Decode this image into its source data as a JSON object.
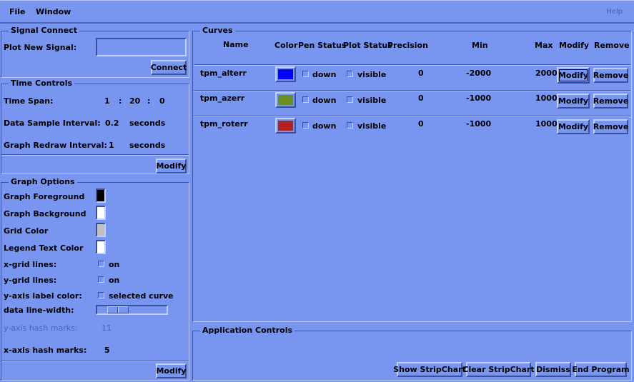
{
  "menu": {
    "file": "File",
    "window": "Window",
    "help": "Help"
  },
  "signal_connect": {
    "title": "Signal Connect",
    "plot_label": "Plot New Signal:",
    "plot_value": "",
    "connect_button": "Connect"
  },
  "time_controls": {
    "title": "Time Controls",
    "span_label": "Time Span:",
    "span_h": "1",
    "span_m": "20",
    "span_s": "0",
    "colon": ":",
    "sample_label": "Data Sample Interval:",
    "sample_value": "0.2",
    "sample_unit": "seconds",
    "redraw_label": "Graph Redraw Interval:",
    "redraw_value": "1",
    "redraw_unit": "seconds",
    "modify_button": "Modify"
  },
  "graph_options": {
    "title": "Graph Options",
    "foreground_label": "Graph Foreground",
    "foreground_color": "#000000",
    "background_label": "Graph Background",
    "background_color": "#ffffff",
    "grid_label": "Grid Color",
    "grid_color": "#c0c0c0",
    "legend_label": "Legend Text Color",
    "legend_color": "#ffffff",
    "xgrid_label": "x-grid lines:",
    "xgrid_value": "on",
    "ygrid_label": "y-grid lines:",
    "ygrid_value": "on",
    "yaxis_color_label": "y-axis label color:",
    "yaxis_color_value": "selected curve",
    "linewidth_label": "data line-width:",
    "yhash_label": "y-axis hash marks:",
    "yhash_value": "11",
    "xhash_label": "x-axis hash marks:",
    "xhash_value": "5",
    "modify_button": "Modify"
  },
  "curves": {
    "title": "Curves",
    "headers": {
      "name": "Name",
      "color": "Color",
      "pen": "Pen Status",
      "plot": "Plot Status",
      "precision": "Precision",
      "min": "Min",
      "max": "Max",
      "modify": "Modify",
      "remove": "Remove"
    },
    "rows": [
      {
        "name": "tpm_alterr",
        "color": "#0000ff",
        "pen": "down",
        "plot": "visible",
        "precision": "0",
        "min": "-2000",
        "max": "2000",
        "modify": "Modify",
        "remove": "Remove"
      },
      {
        "name": "tpm_azerr",
        "color": "#6b8e23",
        "pen": "down",
        "plot": "visible",
        "precision": "0",
        "min": "-1000",
        "max": "1000",
        "modify": "Modify",
        "remove": "Remove"
      },
      {
        "name": "tpm_roterr",
        "color": "#b22222",
        "pen": "down",
        "plot": "visible",
        "precision": "0",
        "min": "-1000",
        "max": "1000",
        "modify": "Modify",
        "remove": "Remove"
      }
    ]
  },
  "app_controls": {
    "title": "Application Controls",
    "show": "Show StripChart",
    "clear": "Clear StripChart",
    "dismiss": "Dismiss",
    "end": "End Program"
  }
}
